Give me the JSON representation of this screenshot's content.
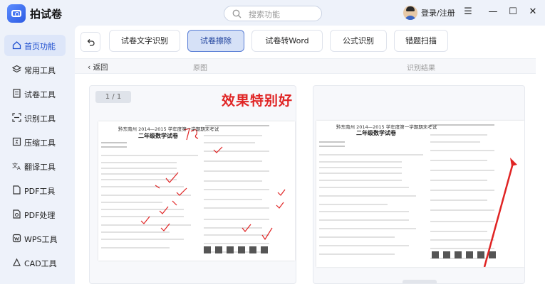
{
  "app": {
    "title": "拍试卷"
  },
  "search": {
    "placeholder": "搜索功能"
  },
  "account": {
    "login_label": "登录/注册"
  },
  "window_controls": {
    "menu": "☰",
    "minimize": "—",
    "maximize": "☐",
    "close": "✕"
  },
  "sidebar": {
    "items": [
      {
        "label": "首页功能",
        "icon": "home-icon",
        "active": true
      },
      {
        "label": "常用工具",
        "icon": "layers-icon",
        "active": false
      },
      {
        "label": "试卷工具",
        "icon": "exam-doc-icon",
        "active": false
      },
      {
        "label": "识别工具",
        "icon": "scan-icon",
        "active": false
      },
      {
        "label": "压缩工具",
        "icon": "compress-icon",
        "active": false
      },
      {
        "label": "翻译工具",
        "icon": "translate-icon",
        "active": false
      },
      {
        "label": "PDF工具",
        "icon": "pdf-icon",
        "active": false
      },
      {
        "label": "PDF处理",
        "icon": "pdf-process-icon",
        "active": false
      },
      {
        "label": "WPS工具",
        "icon": "wps-icon",
        "active": false
      },
      {
        "label": "CAD工具",
        "icon": "cad-icon",
        "active": false
      }
    ]
  },
  "tabs": [
    {
      "label": "试卷文字识别",
      "active": false
    },
    {
      "label": "试卷擦除",
      "active": true
    },
    {
      "label": "试卷转Word",
      "active": false
    },
    {
      "label": "公式识别",
      "active": false
    },
    {
      "label": "错题扫描",
      "active": false
    }
  ],
  "subbar": {
    "back_label": "返回",
    "original_label": "原图",
    "result_label": "识别结果"
  },
  "viewer": {
    "page_indicator": "1 / 1",
    "promo_text": "效果特别好",
    "paper": {
      "heading": "黔东南州 2014—2015 学年度第一学期期末考试",
      "subheading": "二年级数学试卷"
    }
  },
  "colors": {
    "accent": "#2d5be3",
    "promo": "#e02424",
    "active_tab_bg": "#d6e1f7",
    "annotation": "#e02424"
  }
}
